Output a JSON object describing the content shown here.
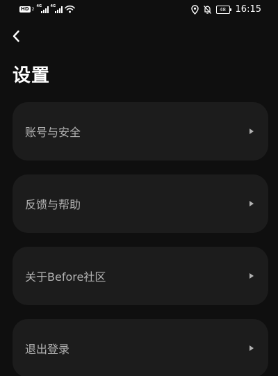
{
  "status_bar": {
    "hd_badge": "HD",
    "sim_number": "2",
    "network_type_1": "4G",
    "network_type_2": "4G",
    "battery_level": "48",
    "time": "16:15",
    "icons": [
      "hd-icon",
      "signal-icon",
      "signal-icon",
      "wifi-icon",
      "location-icon",
      "mute-icon",
      "battery-icon"
    ]
  },
  "header": {
    "back_icon": "chevron-left-icon",
    "title": "设置"
  },
  "settings": {
    "items": [
      {
        "label": "账号与安全",
        "icon": "caret-right-icon"
      },
      {
        "label": "反馈与帮助",
        "icon": "caret-right-icon"
      },
      {
        "label": "关于Before社区",
        "icon": "caret-right-icon"
      },
      {
        "label": "退出登录",
        "icon": "caret-right-icon"
      }
    ]
  },
  "colors": {
    "background": "#0f0f0f",
    "card": "#1c1c1c",
    "title_text": "#ffffff",
    "item_text": "#b3b3b3"
  }
}
